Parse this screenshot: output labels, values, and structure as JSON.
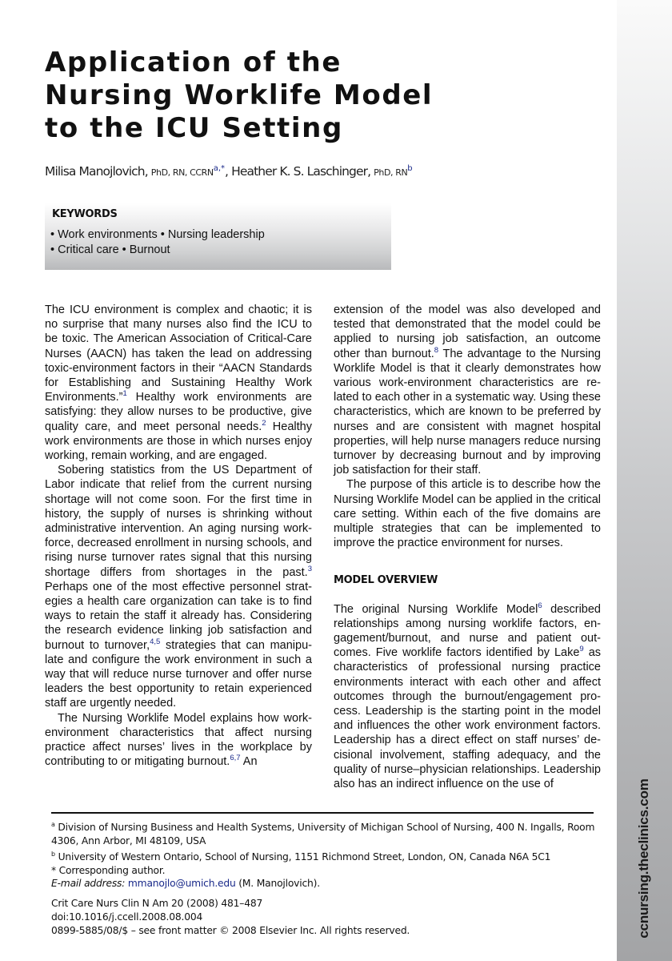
{
  "title": [
    "Application of the",
    "Nursing Worklife Model",
    "to the ICU Setting"
  ],
  "authors": [
    {
      "name": "Milisa Manojlovich,",
      "degrees": "PhD, RN, CCRN",
      "affil": "a,*"
    },
    {
      "name": ", Heather K. S. Laschinger,",
      "degrees": "PhD, RN",
      "affil": "b"
    }
  ],
  "keywords": {
    "heading": "KEYWORDS",
    "line1": "• Work environments • Nursing leadership",
    "line2": "• Critical care • Burnout"
  },
  "left_column": {
    "p1": [
      "The ICU environment is complex and chaotic; it is no surprise that many nurses also find the ICU to be toxic. The American Association of Critical-Care Nurses (AACN) has taken the lead on addressing toxic-environment factors in their “AACN Standards for Establishing and Sustaining Healthy Work Environments.”",
      "1",
      " Healthy work envi­ronments are satisfying: they allow nurses to be productive, give quality care, and meet personal needs.",
      "2",
      " Healthy work environments are those in which nurses enjoy working, remain working, and are engaged."
    ],
    "p2": [
      "Sobering statistics from the US Department of Labor indicate that relief from the current nursing shortage will not come soon. For the first time in his­tory, the supply of nurses is shrinking without administrative intervention. An aging nursing work­force, decreased enrollment in nursing schools, and rising nurse turnover rates signal that this nurs­ing shortage differs from shortages in the past.",
      "3",
      " Perhaps one of the most effective personnel strat­egies a health care organization can take is to find ways to retain the staff it already has. Considering the research evidence linking job satisfaction and burnout to turnover,",
      "4,5",
      " strategies that can manipu­late and configure the work environment in such a way that will reduce nurse turnover and offer nurse leaders the best opportunity to retain experi­enced staff are urgently needed."
    ],
    "p3": [
      "The Nursing Worklife Model explains how work-environment characteristics that affect nursing practice affect nurses’ lives in the workplace by contributing to or mitigating burnout.",
      "6,7",
      " An"
    ]
  },
  "right_column": {
    "p1": [
      "extension of the model was also developed and tested that demonstrated that the model could be applied to nursing job satisfaction, an outcome other than burnout.",
      "8",
      " The advantage to the Nursing Worklife Model is that it clearly demonstrates how various work-environment characteristics are re­lated to each other in a systematic way. Using these characteristics, which are known to be pre­ferred by nurses and are consistent with magnet hospital properties, will help nurse managers re­duce nursing turnover by decreasing burnout and by improving job satisfaction for their staff."
    ],
    "p2": "The purpose of this article is to describe how the Nursing Worklife Model can be applied in the crit­ical care setting. Within each of the five domains are multiple strategies that can be implemented to improve the practice environment for nurses.",
    "section_heading": "MODEL OVERVIEW",
    "p3": [
      "The original Nursing Worklife Model",
      "6",
      " described relationships among nursing worklife factors, en­gagement/burnout, and nurse and patient out­comes. Five worklife factors identified by Lake",
      "9",
      " as characteristics of professional nursing practice environments interact with each other and affect outcomes through the burnout/engagement pro­cess. Leadership is the starting point in the model and influences the other work environment factors. Leadership has a direct effect on staff nurses’ de­cisional involvement, staffing adequacy, and the quality of nurse–physician relationships. Leader­ship also has an indirect influence on the use of"
    ]
  },
  "footnotes": {
    "a_mark": "a",
    "a": " Division of Nursing Business and Health Systems, University of Michigan School of Nursing, 400 N. Ingalls, Room 4306, Ann Arbor, MI 48109, USA",
    "b_mark": "b",
    "b": " University of Western Ontario, School of Nursing, 1151 Richmond Street, London, ON, Canada N6A 5C1",
    "corresponding": "* Corresponding author.",
    "email_label": "E-mail address:",
    "email": "mmanojlo@umich.edu",
    "email_suffix": " (M. Manojlovich)."
  },
  "citation": {
    "journal": "Crit Care Nurs Clin N Am 20 (2008) 481–487",
    "doi": "doi:10.1016/j.ccell.2008.08.004",
    "copyright": "0899-5885/08/$ – see front matter © 2008 Elsevier Inc. All rights reserved."
  },
  "sidebar": {
    "url": "ccnursing.theclinics.com"
  }
}
